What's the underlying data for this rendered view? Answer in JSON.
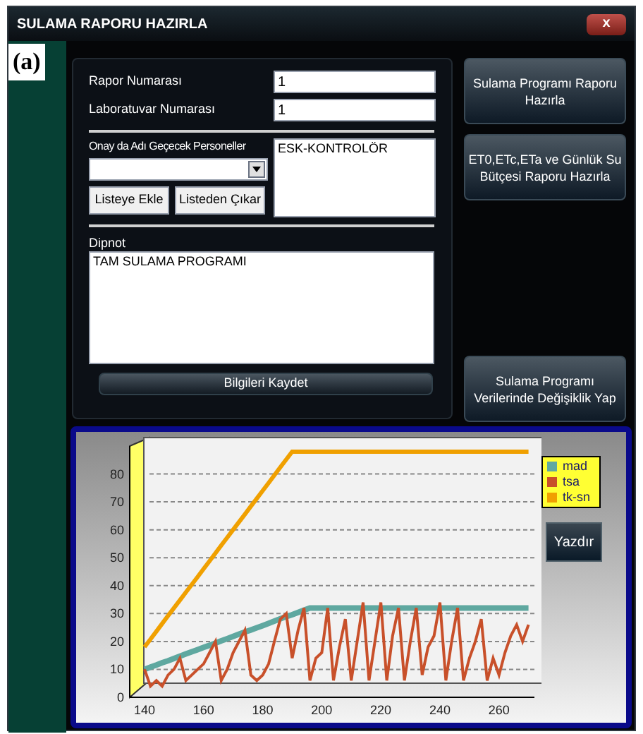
{
  "window": {
    "title": "SULAMA RAPORU HAZIRLA",
    "close": "x"
  },
  "panel_label": "(a)",
  "fields": [
    {
      "label": "Rapor Numarası",
      "value": "1"
    },
    {
      "label": "Laboratuvar Numarası",
      "value": "1"
    }
  ],
  "personnel": {
    "label": "Onay da Adı Geçecek Personeller",
    "buttons": [
      "Listeye Ekle",
      "Listeden Çıkar"
    ],
    "list": [
      "ESK-KONTROLÖR"
    ]
  },
  "footnote": {
    "label": "Dipnot",
    "value": "TAM SULAMA PROGRAMI"
  },
  "save_button": "Bilgileri Kaydet",
  "side_buttons": [
    "Sulama Programı Raporu Hazırla",
    "ET0,ETc,ETa ve Günlük Su Bütçesi  Raporu Hazırla",
    "Sulama Programı Verilerinde Değişiklik Yap"
  ],
  "chart": {
    "print_button": "Yazdır",
    "chart_data": {
      "type": "line",
      "x": [
        140,
        142,
        144,
        146,
        148,
        150,
        152,
        154,
        156,
        158,
        160,
        162,
        164,
        166,
        168,
        170,
        172,
        174,
        176,
        178,
        180,
        182,
        184,
        186,
        188,
        190,
        192,
        194,
        196,
        198,
        200,
        202,
        204,
        206,
        208,
        210,
        212,
        214,
        216,
        218,
        220,
        222,
        224,
        226,
        228,
        230,
        232,
        234,
        236,
        238,
        240,
        242,
        244,
        246,
        248,
        250,
        252,
        254,
        256,
        258,
        260,
        262,
        264,
        266,
        268,
        270
      ],
      "series": [
        {
          "name": "mad",
          "color": "#5fa8a0",
          "values": [
            10,
            10.8,
            11.6,
            12.4,
            13.1,
            13.9,
            14.7,
            15.5,
            16.3,
            17.1,
            17.9,
            18.6,
            19.4,
            20.2,
            21,
            21.8,
            22.6,
            23.4,
            24.1,
            24.9,
            25.7,
            26.5,
            27.3,
            28.1,
            28.9,
            29.6,
            30.4,
            31.2,
            32,
            32,
            32,
            32,
            32,
            32,
            32,
            32,
            32,
            32,
            32,
            32,
            32,
            32,
            32,
            32,
            32,
            32,
            32,
            32,
            32,
            32,
            32,
            32,
            32,
            32,
            32,
            32,
            32,
            32,
            32,
            32,
            32,
            32,
            32,
            32,
            32,
            32
          ]
        },
        {
          "name": "tsa",
          "color": "#c8502a",
          "values": [
            10,
            4,
            6,
            4,
            8,
            10,
            14,
            6,
            8,
            10,
            12,
            16,
            20,
            6,
            10,
            16,
            20,
            24,
            8,
            6,
            8,
            12,
            20,
            28,
            30,
            14,
            24,
            32,
            6,
            14,
            16,
            32,
            6,
            18,
            28,
            6,
            20,
            34,
            6,
            20,
            34,
            6,
            22,
            32,
            6,
            20,
            32,
            8,
            18,
            22,
            34,
            6,
            20,
            32,
            6,
            14,
            20,
            28,
            6,
            14,
            8,
            16,
            22,
            26,
            20,
            26
          ]
        },
        {
          "name": "tk-sn",
          "color": "#f0a000",
          "values": [
            18,
            20.8,
            23.6,
            26.4,
            29.2,
            32,
            34.8,
            37.6,
            40.4,
            43.2,
            46,
            48.8,
            51.6,
            54.4,
            57.2,
            60,
            62.8,
            65.6,
            68.4,
            71.2,
            74,
            76.8,
            79.6,
            82.4,
            85.2,
            88,
            88,
            88,
            88,
            88,
            88,
            88,
            88,
            88,
            88,
            88,
            88,
            88,
            88,
            88,
            88,
            88,
            88,
            88,
            88,
            88,
            88,
            88,
            88,
            88,
            88,
            88,
            88,
            88,
            88,
            88,
            88,
            88,
            88,
            88,
            88,
            88,
            88,
            88,
            88,
            88
          ]
        }
      ],
      "xticks": [
        140,
        160,
        180,
        200,
        220,
        240,
        260
      ],
      "yticks": [
        0,
        10,
        20,
        30,
        40,
        50,
        60,
        70,
        80
      ],
      "grid": true,
      "xlim": [
        135,
        272
      ],
      "ylim": [
        0,
        90
      ]
    }
  }
}
